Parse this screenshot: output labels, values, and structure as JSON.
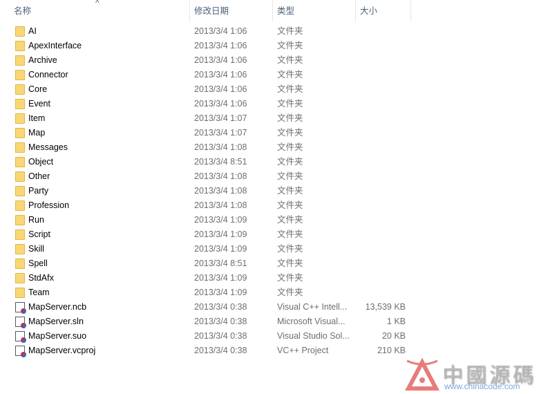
{
  "header": {
    "name": "名称",
    "date": "修改日期",
    "type": "类型",
    "size": "大小"
  },
  "rows": [
    {
      "name": "AI",
      "date": "2013/3/4 1:06",
      "type": "文件夹",
      "size": "",
      "icon": "folder-icon"
    },
    {
      "name": "ApexInterface",
      "date": "2013/3/4 1:06",
      "type": "文件夹",
      "size": "",
      "icon": "folder-icon"
    },
    {
      "name": "Archive",
      "date": "2013/3/4 1:06",
      "type": "文件夹",
      "size": "",
      "icon": "folder-icon"
    },
    {
      "name": "Connector",
      "date": "2013/3/4 1:06",
      "type": "文件夹",
      "size": "",
      "icon": "folder-icon"
    },
    {
      "name": "Core",
      "date": "2013/3/4 1:06",
      "type": "文件夹",
      "size": "",
      "icon": "folder-icon"
    },
    {
      "name": "Event",
      "date": "2013/3/4 1:06",
      "type": "文件夹",
      "size": "",
      "icon": "folder-icon"
    },
    {
      "name": "Item",
      "date": "2013/3/4 1:07",
      "type": "文件夹",
      "size": "",
      "icon": "folder-icon"
    },
    {
      "name": "Map",
      "date": "2013/3/4 1:07",
      "type": "文件夹",
      "size": "",
      "icon": "folder-icon"
    },
    {
      "name": "Messages",
      "date": "2013/3/4 1:08",
      "type": "文件夹",
      "size": "",
      "icon": "folder-icon"
    },
    {
      "name": "Object",
      "date": "2013/3/4 8:51",
      "type": "文件夹",
      "size": "",
      "icon": "folder-icon"
    },
    {
      "name": "Other",
      "date": "2013/3/4 1:08",
      "type": "文件夹",
      "size": "",
      "icon": "folder-icon"
    },
    {
      "name": "Party",
      "date": "2013/3/4 1:08",
      "type": "文件夹",
      "size": "",
      "icon": "folder-icon"
    },
    {
      "name": "Profession",
      "date": "2013/3/4 1:08",
      "type": "文件夹",
      "size": "",
      "icon": "folder-icon"
    },
    {
      "name": "Run",
      "date": "2013/3/4 1:09",
      "type": "文件夹",
      "size": "",
      "icon": "folder-icon"
    },
    {
      "name": "Script",
      "date": "2013/3/4 1:09",
      "type": "文件夹",
      "size": "",
      "icon": "folder-icon"
    },
    {
      "name": "Skill",
      "date": "2013/3/4 1:09",
      "type": "文件夹",
      "size": "",
      "icon": "folder-icon"
    },
    {
      "name": "Spell",
      "date": "2013/3/4 8:51",
      "type": "文件夹",
      "size": "",
      "icon": "folder-icon"
    },
    {
      "name": "StdAfx",
      "date": "2013/3/4 1:09",
      "type": "文件夹",
      "size": "",
      "icon": "folder-icon"
    },
    {
      "name": "Team",
      "date": "2013/3/4 1:09",
      "type": "文件夹",
      "size": "",
      "icon": "folder-icon"
    },
    {
      "name": "MapServer.ncb",
      "date": "2013/3/4 0:38",
      "type": "Visual C++ Intell...",
      "size": "13,539 KB",
      "icon": "ncb-file-icon"
    },
    {
      "name": "MapServer.sln",
      "date": "2013/3/4 0:38",
      "type": "Microsoft Visual...",
      "size": "1 KB",
      "icon": "sln-file-icon"
    },
    {
      "name": "MapServer.suo",
      "date": "2013/3/4 0:38",
      "type": "Visual Studio Sol...",
      "size": "20 KB",
      "icon": "suo-file-icon"
    },
    {
      "name": "MapServer.vcproj",
      "date": "2013/3/4 0:38",
      "type": "VC++ Project",
      "size": "210 KB",
      "icon": "vcproj-file-icon"
    }
  ],
  "watermark": {
    "text": "中國源碼",
    "url": "www.chinacode.com"
  }
}
